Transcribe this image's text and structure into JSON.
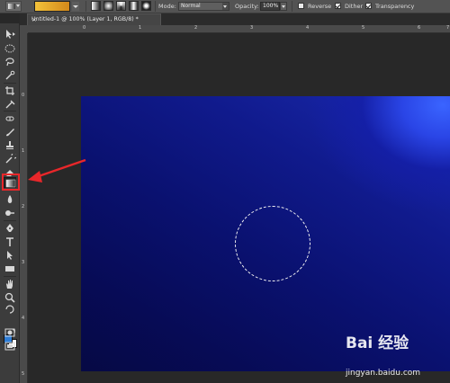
{
  "options_bar": {
    "tool_preset_icon": "gradient-tool-icon",
    "gradient_swatch_colors": [
      "#f3c23a",
      "#d4891a"
    ],
    "gradient_types": [
      "linear-gradient-icon",
      "radial-gradient-icon",
      "angle-gradient-icon",
      "reflected-gradient-icon",
      "diamond-gradient-icon"
    ],
    "mode_label": "Mode:",
    "mode_value": "Normal",
    "opacity_label": "Opacity:",
    "opacity_value": "100%",
    "reverse_label": "Reverse",
    "reverse_checked": false,
    "dither_label": "Dither",
    "dither_checked": true,
    "transparency_label": "Transparency",
    "transparency_checked": true
  },
  "document_tab": {
    "title": "Untitled-1 @ 100% (Layer 1, RGB/8) *",
    "close": "×"
  },
  "rulers": {
    "top": [
      "0",
      "1",
      "2",
      "3",
      "4",
      "5",
      "6",
      "7"
    ],
    "left": [
      "0",
      "1",
      "2",
      "3",
      "4",
      "5"
    ]
  },
  "toolbox": {
    "selected_tool": "gradient-tool",
    "foreground_color": "#2e7dd6",
    "background_color": "#ffffff"
  },
  "canvas": {
    "colors": {
      "dark": "#060944",
      "mid": "#101a8c",
      "bright": "#3a64ff"
    },
    "selection_shape": "elliptical-marquee"
  },
  "watermark": {
    "logo": "Bai 经验",
    "url": "jingyan.baidu.com"
  },
  "annotation": {
    "arrow_color": "#e8272a",
    "highlight_color": "#e8272a"
  }
}
